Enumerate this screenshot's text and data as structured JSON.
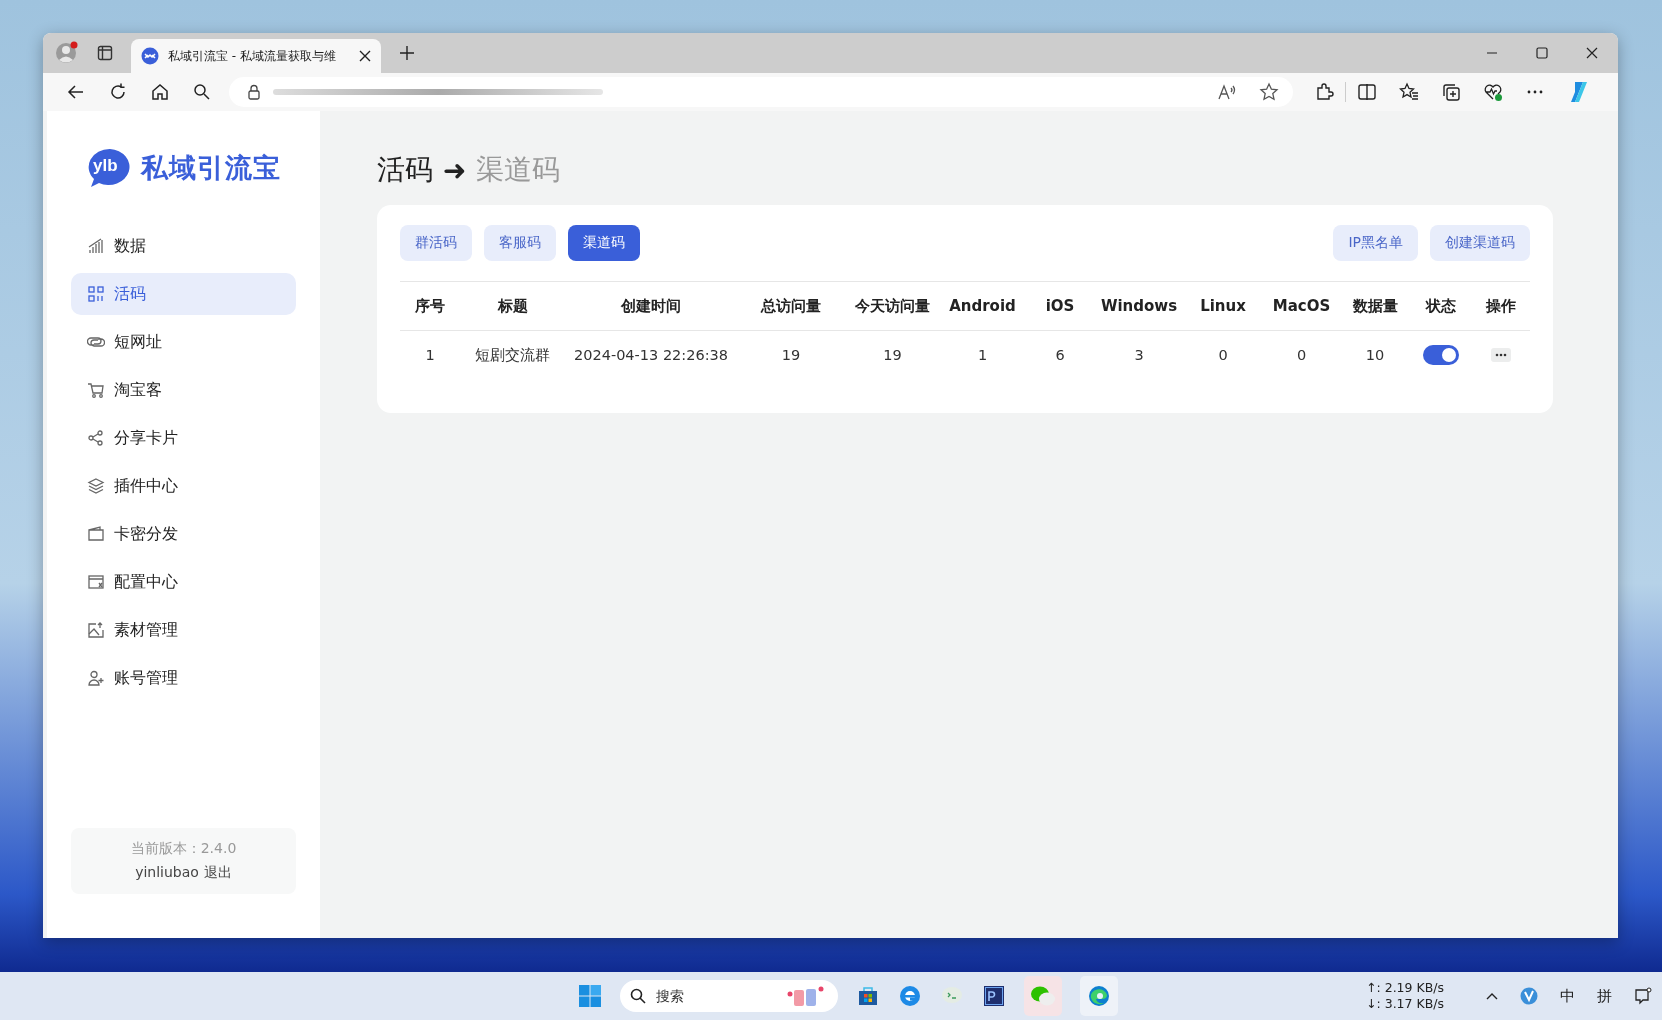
{
  "browser": {
    "tab_title": "私域引流宝 - 私域流量获取与维"
  },
  "sidebar": {
    "logo_mark": "ylb",
    "logo_text": "私域引流宝",
    "items": [
      {
        "label": "数据",
        "kind": "chart",
        "selected": false
      },
      {
        "label": "活码",
        "kind": "grid",
        "selected": true
      },
      {
        "label": "短网址",
        "kind": "link",
        "selected": false
      },
      {
        "label": "淘宝客",
        "kind": "cart",
        "selected": false
      },
      {
        "label": "分享卡片",
        "kind": "share",
        "selected": false
      },
      {
        "label": "插件中心",
        "kind": "layers",
        "selected": false
      },
      {
        "label": "卡密分发",
        "kind": "card",
        "selected": false
      },
      {
        "label": "配置中心",
        "kind": "config",
        "selected": false
      },
      {
        "label": "素材管理",
        "kind": "image",
        "selected": false
      },
      {
        "label": "账号管理",
        "kind": "user",
        "selected": false
      }
    ],
    "version": "当前版本：2.4.0",
    "user": "yinliubao",
    "logout": "退出"
  },
  "breadcrumb": {
    "parent": "活码",
    "separator": "➜",
    "current": "渠道码"
  },
  "tabs": [
    {
      "label": "群活码",
      "selected": false
    },
    {
      "label": "客服码",
      "selected": false
    },
    {
      "label": "渠道码",
      "selected": true
    }
  ],
  "actions": [
    "IP黑名单",
    "创建渠道码"
  ],
  "table": {
    "columns": [
      "序号",
      "标题",
      "创建时间",
      "总访问量",
      "今天访问量",
      "Android",
      "iOS",
      "Windows",
      "Linux",
      "MacOS",
      "数据量",
      "状态",
      "操作"
    ],
    "rows": [
      {
        "cells": [
          "1",
          "短剧交流群",
          "2024-04-13 22:26:38",
          "19",
          "19",
          "1",
          "6",
          "3",
          "0",
          "0",
          "10"
        ],
        "on": true
      }
    ]
  },
  "taskbar": {
    "search_placeholder": "搜索",
    "upload": "↑: 2.19 KB/s",
    "download": "↓: 3.17 KB/s",
    "ime": "中",
    "ime_mode": "拼"
  }
}
